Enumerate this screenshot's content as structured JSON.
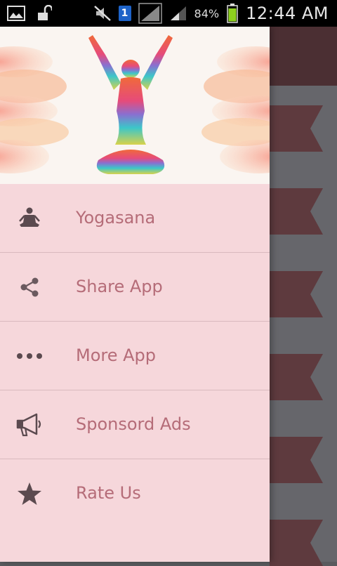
{
  "status_bar": {
    "battery_percent": "84%",
    "time": "12:44 AM",
    "notification_badge": "1",
    "icons": [
      "image-icon",
      "unlock-icon",
      "mute-icon",
      "signal-icon",
      "battery-icon"
    ]
  },
  "drawer": {
    "header_image": "yoga-meditation-illustration",
    "items": [
      {
        "label": "Yogasana",
        "icon": "meditation-icon"
      },
      {
        "label": "Share App",
        "icon": "share-icon"
      },
      {
        "label": "More App",
        "icon": "more-dots-icon"
      },
      {
        "label": "Sponsord Ads",
        "icon": "megaphone-icon"
      },
      {
        "label": "Rate Us",
        "icon": "star-icon"
      }
    ]
  },
  "colors": {
    "drawer_bg": "#f6d7db",
    "label_text": "#b56c78",
    "icon": "#5b4a4f",
    "ribbon": "#5e3a3e",
    "toolbar": "#4b2f33"
  }
}
